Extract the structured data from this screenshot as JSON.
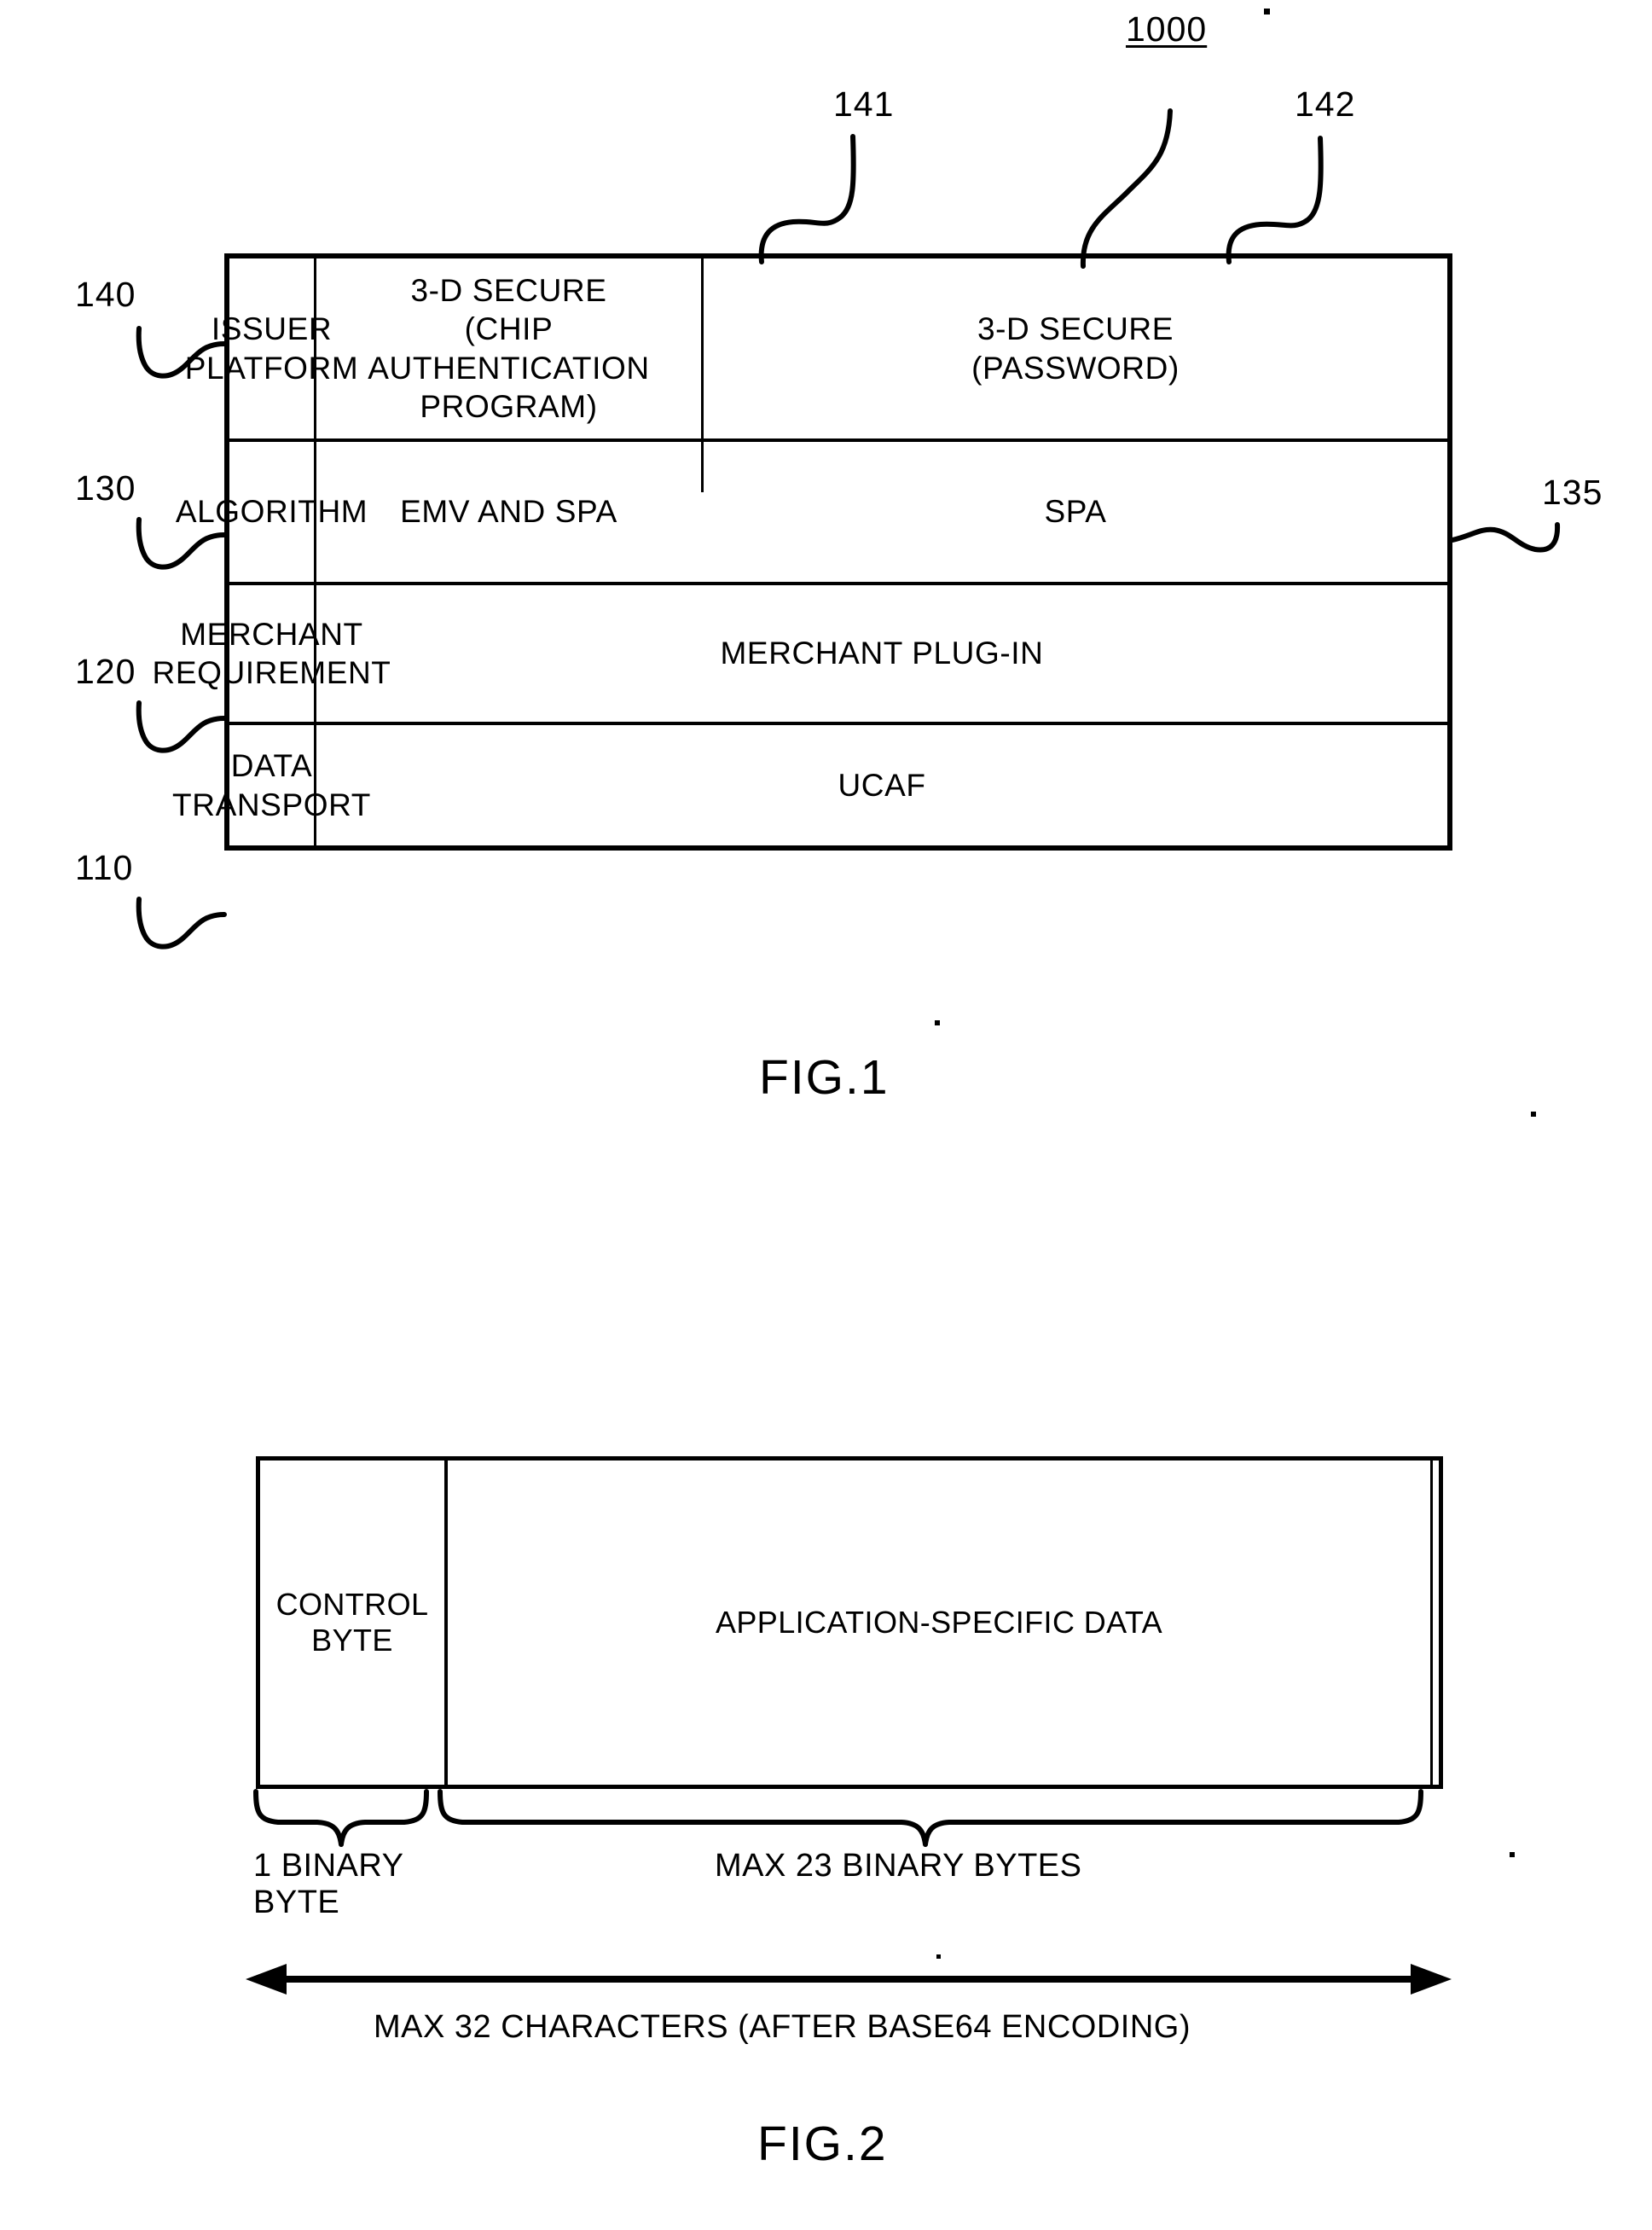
{
  "figure1": {
    "assembly_ref": "1000",
    "row_refs": [
      "140",
      "130",
      "120",
      "110"
    ],
    "column_refs": [
      "141",
      "142"
    ],
    "right_ref": "135",
    "caption": "FIG.1",
    "rows": [
      {
        "label": "ISSUER\nPLATFORM",
        "ref": "140",
        "cells": [
          {
            "text": "3-D SECURE\n(CHIP AUTHENTICATION\nPROGRAM)",
            "span": 1
          },
          {
            "text": "3-D SECURE\n(PASSWORD)",
            "span": 1
          }
        ]
      },
      {
        "label": "ALGORITHM",
        "ref": "130",
        "cells": [
          {
            "text": "EMV AND SPA",
            "span": 1
          },
          {
            "text": "SPA",
            "span": 1
          }
        ]
      },
      {
        "label": "MERCHANT\nREQUIREMENT",
        "ref": "120",
        "cells": [
          {
            "text": "MERCHANT PLUG-IN",
            "span": 2
          }
        ]
      },
      {
        "label": "DATA\nTRANSPORT",
        "ref": "110",
        "cells": [
          {
            "text": "UCAF",
            "span": 2
          }
        ]
      }
    ]
  },
  "figure2": {
    "caption": "FIG.2",
    "fields": [
      {
        "text": "CONTROL\nBYTE"
      },
      {
        "text": "APPLICATION-SPECIFIC DATA"
      }
    ],
    "brace_labels": [
      {
        "text": "1 BINARY\nBYTE"
      },
      {
        "text": "MAX 23 BINARY BYTES"
      }
    ],
    "overall_label": "MAX 32 CHARACTERS (AFTER BASE64 ENCODING)"
  },
  "colors": {
    "ink": "#000000",
    "paper": "#ffffff"
  }
}
